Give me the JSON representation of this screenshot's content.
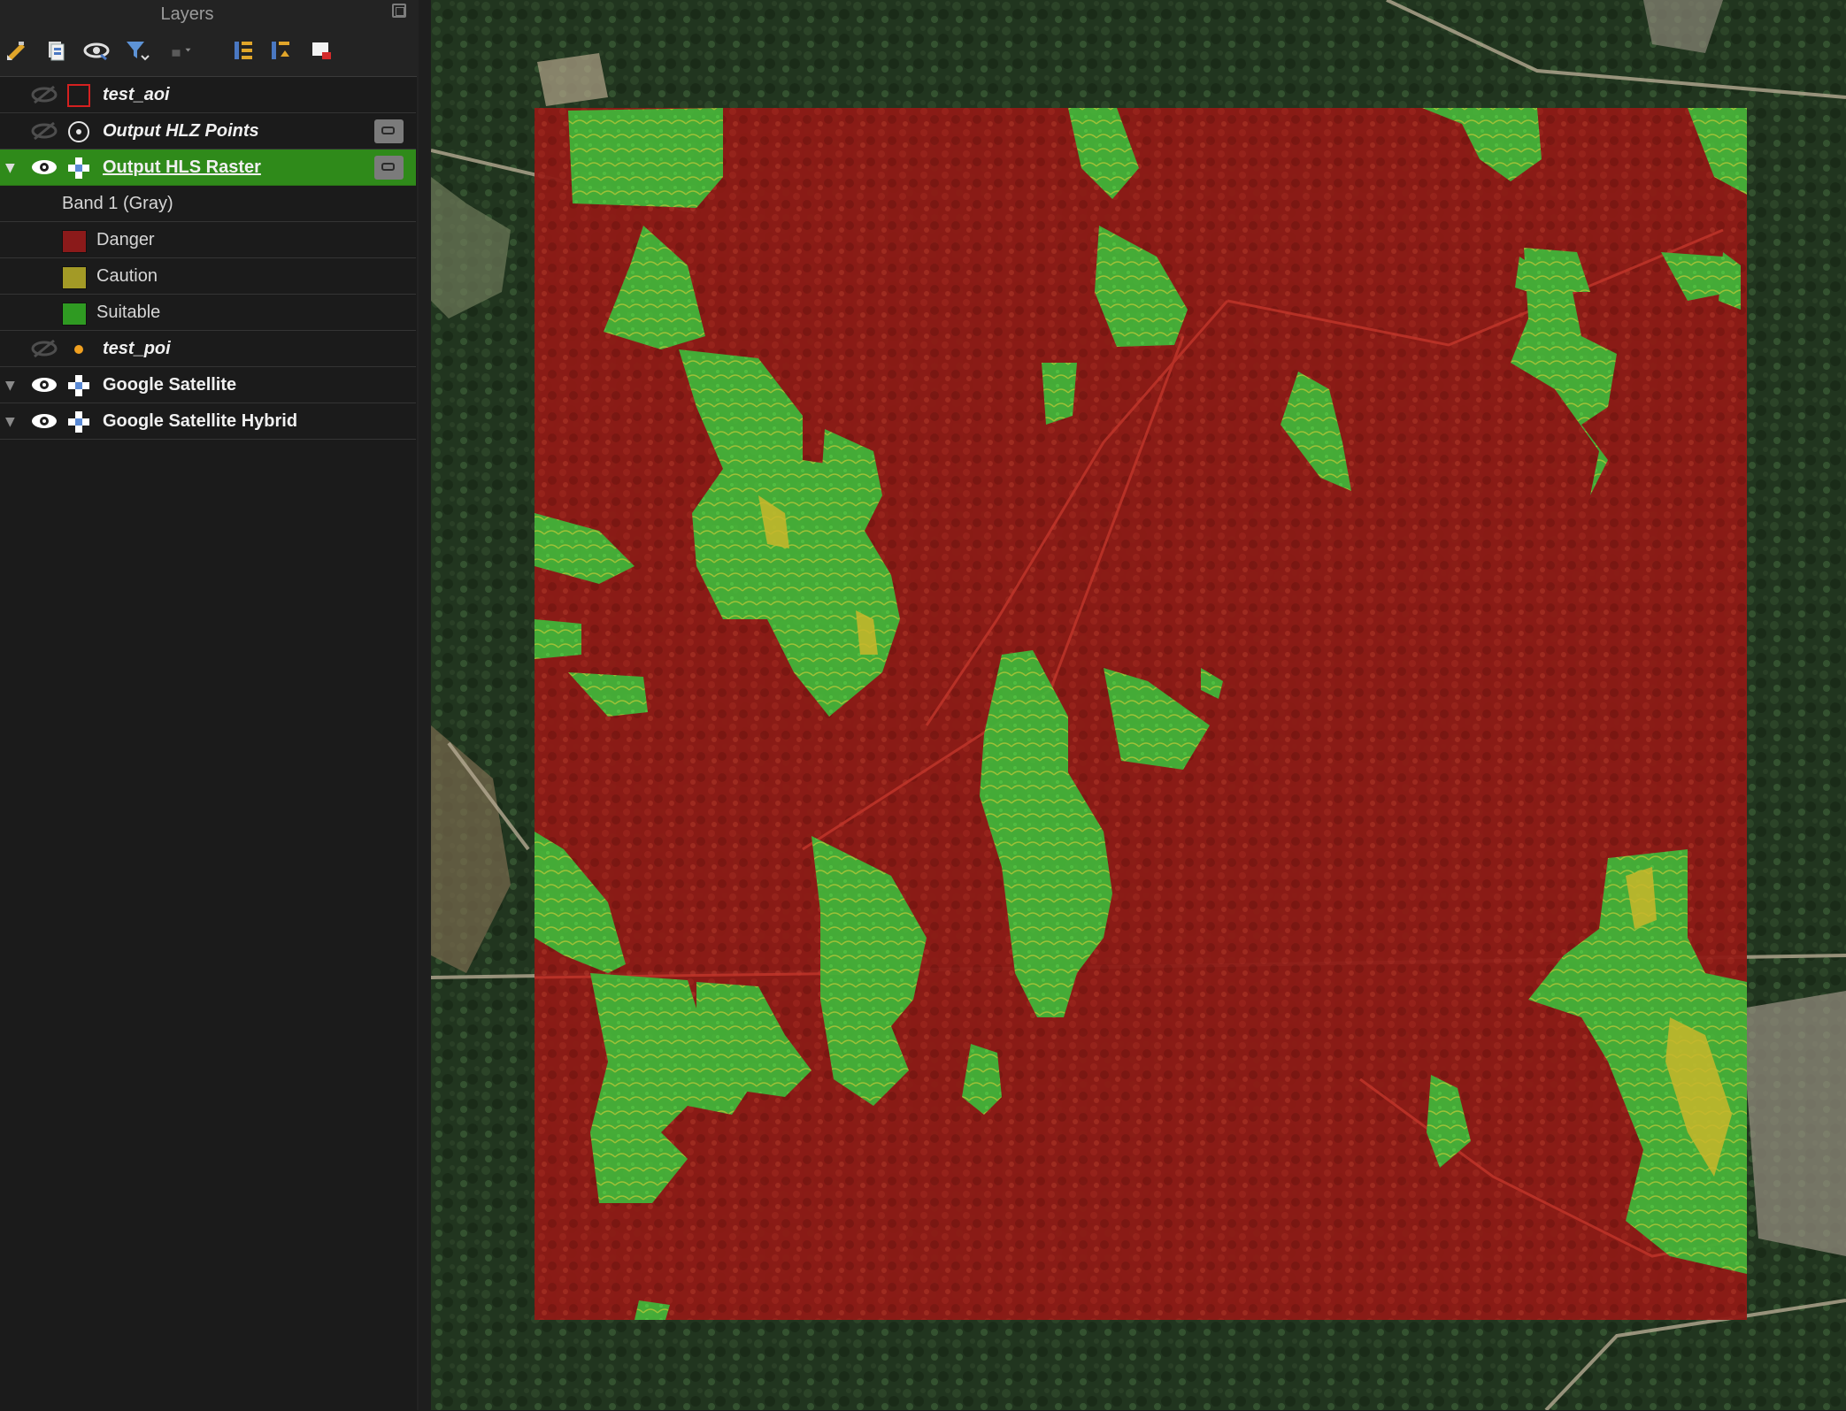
{
  "panel": {
    "title": "Layers"
  },
  "toolbar": {
    "items": [
      {
        "name": "add-group-icon"
      },
      {
        "name": "manage-themes-icon"
      },
      {
        "name": "visibility-icon"
      },
      {
        "name": "filter-legend-icon"
      },
      {
        "name": "filter-expression-icon"
      },
      {
        "name": "expand-all-icon"
      },
      {
        "name": "collapse-all-icon"
      },
      {
        "name": "remove-layer-icon"
      }
    ]
  },
  "layers": [
    {
      "name": "test_aoi",
      "italic": true,
      "visible": false,
      "icon": "polygon-layer-icon"
    },
    {
      "name": "Output HLZ Points",
      "italic": true,
      "visible": false,
      "icon": "point-layer-icon"
    },
    {
      "name": "Output HLS Raster",
      "italic": false,
      "visible": true,
      "selected": true,
      "icon": "raster-layer-icon"
    },
    {
      "name": "test_poi",
      "italic": true,
      "visible": false,
      "icon": "point-dot-icon"
    },
    {
      "name": "Google Satellite",
      "italic": false,
      "visible": true,
      "icon": "raster-layer-icon"
    },
    {
      "name": "Google Satellite Hybrid",
      "italic": false,
      "visible": true,
      "icon": "raster-layer-icon"
    }
  ],
  "legend": {
    "band": "Band 1 (Gray)",
    "classes": [
      {
        "label": "Danger",
        "color": "#8b1a1a"
      },
      {
        "label": "Caution",
        "color": "#a39a26"
      },
      {
        "label": "Suitable",
        "color": "#2f9a22"
      }
    ]
  },
  "colors": {
    "selection": "#2f8a1a",
    "danger_overlay": "#9a1414",
    "suitable_overlay": "#3fd23a"
  }
}
